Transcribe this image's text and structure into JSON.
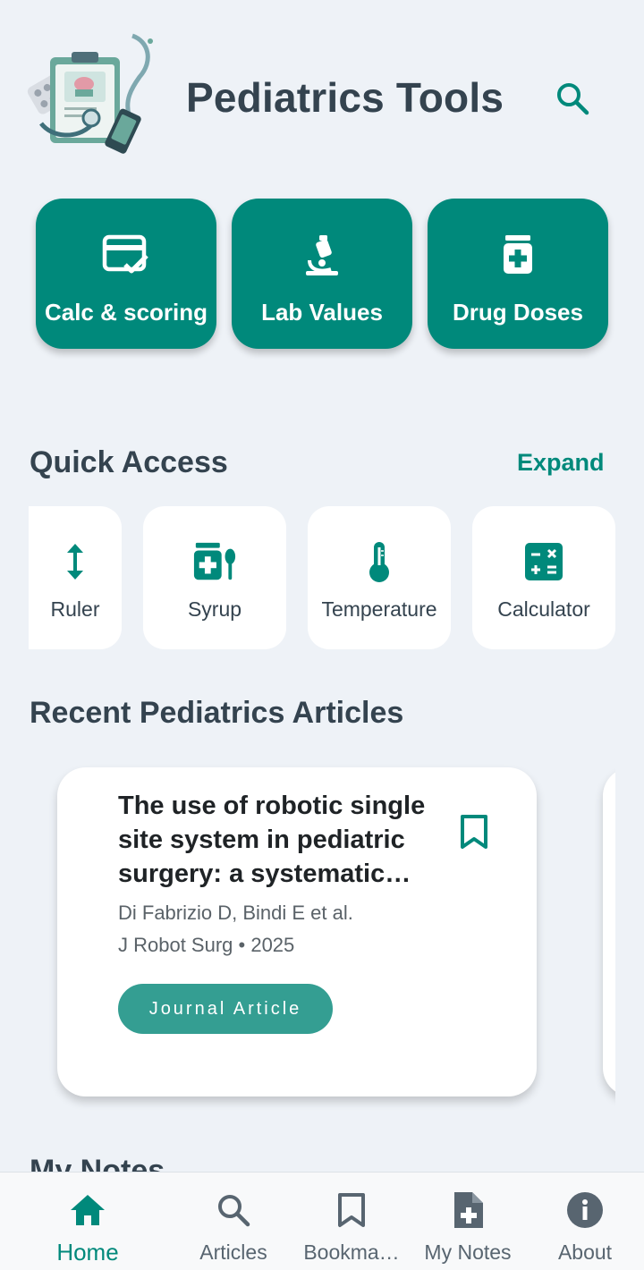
{
  "header": {
    "title": "Pediatrics Tools",
    "logo_icon": "clipboard-stethoscope-illustration",
    "search_icon": "search-icon"
  },
  "tools": [
    {
      "label": "Calc & scoring",
      "icon": "calc-card-check-icon"
    },
    {
      "label": "Lab Values",
      "icon": "microscope-icon"
    },
    {
      "label": "Drug Doses",
      "icon": "medicine-bottle-icon"
    }
  ],
  "quick_access": {
    "title": "Quick Access",
    "expand_label": "Expand",
    "items": [
      {
        "label": "Ruler",
        "icon": "vertical-arrows-icon"
      },
      {
        "label": "Syrup",
        "icon": "syrup-spoon-icon"
      },
      {
        "label": "Temperature",
        "icon": "thermometer-icon"
      },
      {
        "label": "Calculator",
        "icon": "calculator-icon"
      }
    ]
  },
  "articles": {
    "title": "Recent Pediatrics Articles",
    "items": [
      {
        "title": "The use of robotic single site system in pediatric surgery: a systematic review",
        "authors": "Di Fabrizio D, Bindi E et al.",
        "source": "J Robot Surg • 2025",
        "type": "Journal Article"
      }
    ]
  },
  "notes": {
    "title": "My Notes"
  },
  "bottom_nav": {
    "items": [
      {
        "label": "Home",
        "icon": "home-icon",
        "active": true
      },
      {
        "label": "Articles",
        "icon": "search-icon",
        "active": false
      },
      {
        "label": "Bookma…",
        "icon": "bookmark-icon",
        "active": false
      },
      {
        "label": "My Notes",
        "icon": "note-add-icon",
        "active": false
      },
      {
        "label": "About",
        "icon": "info-icon",
        "active": false
      }
    ]
  },
  "colors": {
    "accent": "#00897b",
    "background": "#eef2f7",
    "text": "#34434f",
    "chip": "#349e92"
  }
}
